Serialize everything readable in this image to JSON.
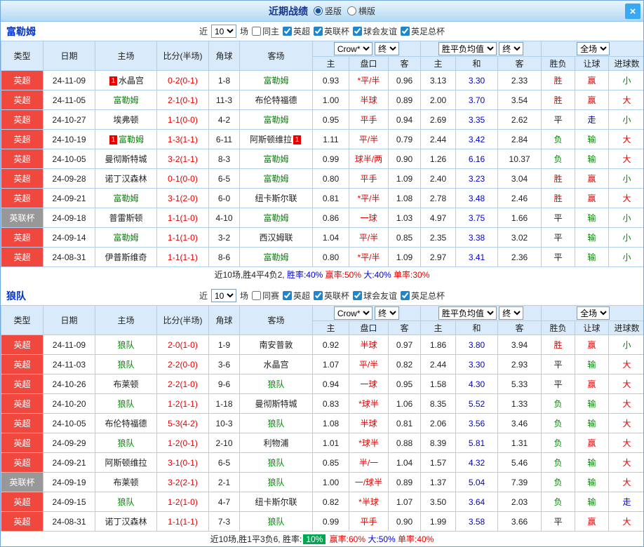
{
  "header": {
    "title": "近期战绩",
    "layout_options": [
      "竖版",
      "横版"
    ],
    "selected_layout": "竖版",
    "close_label": "×"
  },
  "table_columns": {
    "type": "类型",
    "date": "日期",
    "home": "主场",
    "score": "比分(半场)",
    "corner": "角球",
    "away": "客场",
    "odds_select": "Crow*",
    "odds_final_select": "终",
    "odds_sub": [
      "主",
      "盘口",
      "客"
    ],
    "europe_select": "胜平负均值",
    "europe_final_select": "终",
    "europe_sub": [
      "主",
      "和",
      "客"
    ],
    "scope_select": "全场",
    "result_sub": [
      "胜负",
      "让球",
      "进球数"
    ]
  },
  "sections": [
    {
      "team": "富勒姆",
      "filters": {
        "near_label": "近",
        "count": "10",
        "games_label": "场",
        "extra_label": "同主",
        "extra_checked": false,
        "leagues": [
          {
            "label": "英超",
            "checked": true
          },
          {
            "label": "英联杯",
            "checked": true
          },
          {
            "label": "球会友谊",
            "checked": true
          },
          {
            "label": "英足总杯",
            "checked": true
          }
        ]
      },
      "rows": [
        {
          "type": "英超",
          "type_style": "red",
          "date": "24-11-09",
          "home": "水晶宫",
          "home_focus": false,
          "home_badge": "1",
          "score": "0-2(0-1)",
          "corner": "1-8",
          "away": "富勒姆",
          "away_focus": true,
          "away_badge": "",
          "odds_home": "0.93",
          "handicap": "*平/半",
          "odds_away": "0.96",
          "eu_home": "3.13",
          "eu_draw": "3.30",
          "eu_away": "2.33",
          "result": "胜",
          "let_result": "赢",
          "goal_result": "小"
        },
        {
          "type": "英超",
          "type_style": "red",
          "date": "24-11-05",
          "home": "富勒姆",
          "home_focus": true,
          "home_badge": "",
          "score": "2-1(0-1)",
          "corner": "11-3",
          "away": "布伦特福德",
          "away_focus": false,
          "away_badge": "",
          "odds_home": "1.00",
          "handicap": "半球",
          "odds_away": "0.89",
          "eu_home": "2.00",
          "eu_draw": "3.70",
          "eu_away": "3.54",
          "result": "胜",
          "let_result": "赢",
          "goal_result": "大"
        },
        {
          "type": "英超",
          "type_style": "red",
          "date": "24-10-27",
          "home": "埃弗顿",
          "home_focus": false,
          "home_badge": "",
          "score": "1-1(0-0)",
          "corner": "4-2",
          "away": "富勒姆",
          "away_focus": true,
          "away_badge": "",
          "odds_home": "0.95",
          "handicap": "平手",
          "odds_away": "0.94",
          "eu_home": "2.69",
          "eu_draw": "3.35",
          "eu_away": "2.62",
          "result": "平",
          "let_result": "走",
          "goal_result": "小"
        },
        {
          "type": "英超",
          "type_style": "red",
          "date": "24-10-19",
          "home": "富勒姆",
          "home_focus": true,
          "home_badge": "1",
          "score": "1-3(1-1)",
          "corner": "6-11",
          "away": "阿斯顿维拉",
          "away_focus": false,
          "away_badge": "1",
          "odds_home": "1.11",
          "handicap": "平/半",
          "odds_away": "0.79",
          "eu_home": "2.44",
          "eu_draw": "3.42",
          "eu_away": "2.84",
          "result": "负",
          "let_result": "输",
          "goal_result": "大"
        },
        {
          "type": "英超",
          "type_style": "red",
          "date": "24-10-05",
          "home": "曼彻斯特城",
          "home_focus": false,
          "home_badge": "",
          "score": "3-2(1-1)",
          "corner": "8-3",
          "away": "富勒姆",
          "away_focus": true,
          "away_badge": "",
          "odds_home": "0.99",
          "handicap": "球半/两",
          "odds_away": "0.90",
          "eu_home": "1.26",
          "eu_draw": "6.16",
          "eu_away": "10.37",
          "result": "负",
          "let_result": "输",
          "goal_result": "大"
        },
        {
          "type": "英超",
          "type_style": "red",
          "date": "24-09-28",
          "home": "诺丁汉森林",
          "home_focus": false,
          "home_badge": "",
          "score": "0-1(0-0)",
          "corner": "6-5",
          "away": "富勒姆",
          "away_focus": true,
          "away_badge": "",
          "odds_home": "0.80",
          "handicap": "平手",
          "odds_away": "1.09",
          "eu_home": "2.40",
          "eu_draw": "3.23",
          "eu_away": "3.04",
          "result": "胜",
          "let_result": "赢",
          "goal_result": "小"
        },
        {
          "type": "英超",
          "type_style": "red",
          "date": "24-09-21",
          "home": "富勒姆",
          "home_focus": true,
          "home_badge": "",
          "score": "3-1(2-0)",
          "corner": "6-0",
          "away": "纽卡斯尔联",
          "away_focus": false,
          "away_badge": "",
          "odds_home": "0.81",
          "handicap": "*平/半",
          "odds_away": "1.08",
          "eu_home": "2.78",
          "eu_draw": "3.48",
          "eu_away": "2.46",
          "result": "胜",
          "let_result": "赢",
          "goal_result": "大"
        },
        {
          "type": "英联杯",
          "type_style": "gray",
          "date": "24-09-18",
          "home": "普雷斯顿",
          "home_focus": false,
          "home_badge": "",
          "score": "1-1(1-0)",
          "corner": "4-10",
          "away": "富勒姆",
          "away_focus": true,
          "away_badge": "",
          "odds_home": "0.86",
          "handicap": "一球",
          "odds_away": "1.03",
          "eu_home": "4.97",
          "eu_draw": "3.75",
          "eu_away": "1.66",
          "result": "平",
          "let_result": "输",
          "goal_result": "小"
        },
        {
          "type": "英超",
          "type_style": "red",
          "date": "24-09-14",
          "home": "富勒姆",
          "home_focus": true,
          "home_badge": "",
          "score": "1-1(1-0)",
          "corner": "3-2",
          "away": "西汉姆联",
          "away_focus": false,
          "away_badge": "",
          "odds_home": "1.04",
          "handicap": "平/半",
          "odds_away": "0.85",
          "eu_home": "2.35",
          "eu_draw": "3.38",
          "eu_away": "3.02",
          "result": "平",
          "let_result": "输",
          "goal_result": "小"
        },
        {
          "type": "英超",
          "type_style": "red",
          "date": "24-08-31",
          "home": "伊普斯维奇",
          "home_focus": false,
          "home_badge": "",
          "score": "1-1(1-1)",
          "corner": "8-6",
          "away": "富勒姆",
          "away_focus": true,
          "away_badge": "",
          "odds_home": "0.80",
          "handicap": "*平/半",
          "odds_away": "1.09",
          "eu_home": "2.97",
          "eu_draw": "3.41",
          "eu_away": "2.36",
          "result": "平",
          "let_result": "输",
          "goal_result": "小"
        }
      ],
      "summary": [
        {
          "text": "近10场,胜4平4负2, ",
          "style": "dark"
        },
        {
          "text": "胜率:40%",
          "style": "blue"
        },
        {
          "text": " 赢率:50%",
          "style": "red"
        },
        {
          "text": " 大:40%",
          "style": "blue"
        },
        {
          "text": " 单率:30%",
          "style": "red"
        }
      ]
    },
    {
      "team": "狼队",
      "filters": {
        "near_label": "近",
        "count": "10",
        "games_label": "场",
        "extra_label": "同赛",
        "extra_checked": false,
        "leagues": [
          {
            "label": "英超",
            "checked": true
          },
          {
            "label": "英联杯",
            "checked": true
          },
          {
            "label": "球会友谊",
            "checked": true
          },
          {
            "label": "英足总杯",
            "checked": true
          }
        ]
      },
      "rows": [
        {
          "type": "英超",
          "type_style": "red",
          "date": "24-11-09",
          "home": "狼队",
          "home_focus": true,
          "home_badge": "",
          "score": "2-0(1-0)",
          "corner": "1-9",
          "away": "南安普敦",
          "away_focus": false,
          "away_badge": "",
          "odds_home": "0.92",
          "handicap": "半球",
          "odds_away": "0.97",
          "eu_home": "1.86",
          "eu_draw": "3.80",
          "eu_away": "3.94",
          "result": "胜",
          "let_result": "赢",
          "goal_result": "小"
        },
        {
          "type": "英超",
          "type_style": "red",
          "date": "24-11-03",
          "home": "狼队",
          "home_focus": true,
          "home_badge": "",
          "score": "2-2(0-0)",
          "corner": "3-6",
          "away": "水晶宫",
          "away_focus": false,
          "away_badge": "",
          "odds_home": "1.07",
          "handicap": "平/半",
          "odds_away": "0.82",
          "eu_home": "2.44",
          "eu_draw": "3.30",
          "eu_away": "2.93",
          "result": "平",
          "let_result": "输",
          "goal_result": "大"
        },
        {
          "type": "英超",
          "type_style": "red",
          "date": "24-10-26",
          "home": "布莱顿",
          "home_focus": false,
          "home_badge": "",
          "score": "2-2(1-0)",
          "corner": "9-6",
          "away": "狼队",
          "away_focus": true,
          "away_badge": "",
          "odds_home": "0.94",
          "handicap": "一球",
          "odds_away": "0.95",
          "eu_home": "1.58",
          "eu_draw": "4.30",
          "eu_away": "5.33",
          "result": "平",
          "let_result": "赢",
          "goal_result": "大"
        },
        {
          "type": "英超",
          "type_style": "red",
          "date": "24-10-20",
          "home": "狼队",
          "home_focus": true,
          "home_badge": "",
          "score": "1-2(1-1)",
          "corner": "1-18",
          "away": "曼彻斯特城",
          "away_focus": false,
          "away_badge": "",
          "odds_home": "0.83",
          "handicap": "*球半",
          "odds_away": "1.06",
          "eu_home": "8.35",
          "eu_draw": "5.52",
          "eu_away": "1.33",
          "result": "负",
          "let_result": "输",
          "goal_result": "大"
        },
        {
          "type": "英超",
          "type_style": "red",
          "date": "24-10-05",
          "home": "布伦特福德",
          "home_focus": false,
          "home_badge": "",
          "score": "5-3(4-2)",
          "corner": "10-3",
          "away": "狼队",
          "away_focus": true,
          "away_badge": "",
          "odds_home": "1.08",
          "handicap": "半球",
          "odds_away": "0.81",
          "eu_home": "2.06",
          "eu_draw": "3.56",
          "eu_away": "3.46",
          "result": "负",
          "let_result": "输",
          "goal_result": "大"
        },
        {
          "type": "英超",
          "type_style": "red",
          "date": "24-09-29",
          "home": "狼队",
          "home_focus": true,
          "home_badge": "",
          "score": "1-2(0-1)",
          "corner": "2-10",
          "away": "利物浦",
          "away_focus": false,
          "away_badge": "",
          "odds_home": "1.01",
          "handicap": "*球半",
          "odds_away": "0.88",
          "eu_home": "8.39",
          "eu_draw": "5.81",
          "eu_away": "1.31",
          "result": "负",
          "let_result": "赢",
          "goal_result": "大"
        },
        {
          "type": "英超",
          "type_style": "red",
          "date": "24-09-21",
          "home": "阿斯顿维拉",
          "home_focus": false,
          "home_badge": "",
          "score": "3-1(0-1)",
          "corner": "6-5",
          "away": "狼队",
          "away_focus": true,
          "away_badge": "",
          "odds_home": "0.85",
          "handicap": "半/一",
          "odds_away": "1.04",
          "eu_home": "1.57",
          "eu_draw": "4.32",
          "eu_away": "5.46",
          "result": "负",
          "let_result": "输",
          "goal_result": "大"
        },
        {
          "type": "英联杯",
          "type_style": "gray",
          "date": "24-09-19",
          "home": "布莱顿",
          "home_focus": false,
          "home_badge": "",
          "score": "3-2(2-1)",
          "corner": "2-1",
          "away": "狼队",
          "away_focus": true,
          "away_badge": "",
          "odds_home": "1.00",
          "handicap": "一/球半",
          "odds_away": "0.89",
          "eu_home": "1.37",
          "eu_draw": "5.04",
          "eu_away": "7.39",
          "result": "负",
          "let_result": "输",
          "goal_result": "大"
        },
        {
          "type": "英超",
          "type_style": "red",
          "date": "24-09-15",
          "home": "狼队",
          "home_focus": true,
          "home_badge": "",
          "score": "1-2(1-0)",
          "corner": "4-7",
          "away": "纽卡斯尔联",
          "away_focus": false,
          "away_badge": "",
          "odds_home": "0.82",
          "handicap": "*半球",
          "odds_away": "1.07",
          "eu_home": "3.50",
          "eu_draw": "3.64",
          "eu_away": "2.03",
          "result": "负",
          "let_result": "输",
          "goal_result": "走"
        },
        {
          "type": "英超",
          "type_style": "red",
          "date": "24-08-31",
          "home": "诺丁汉森林",
          "home_focus": false,
          "home_badge": "",
          "score": "1-1(1-1)",
          "corner": "7-3",
          "away": "狼队",
          "away_focus": true,
          "away_badge": "",
          "odds_home": "0.99",
          "handicap": "平手",
          "odds_away": "0.90",
          "eu_home": "1.99",
          "eu_draw": "3.58",
          "eu_away": "3.66",
          "result": "平",
          "let_result": "赢",
          "goal_result": "大"
        }
      ],
      "summary": [
        {
          "text": "近10场,胜1平3负6, 胜率:",
          "style": "dark"
        },
        {
          "text": "10%",
          "style": "green-box"
        },
        {
          "text": " 赢率:60%",
          "style": "red"
        },
        {
          "text": " 大:50%",
          "style": "blue"
        },
        {
          "text": " 单率:40%",
          "style": "red"
        }
      ]
    }
  ]
}
